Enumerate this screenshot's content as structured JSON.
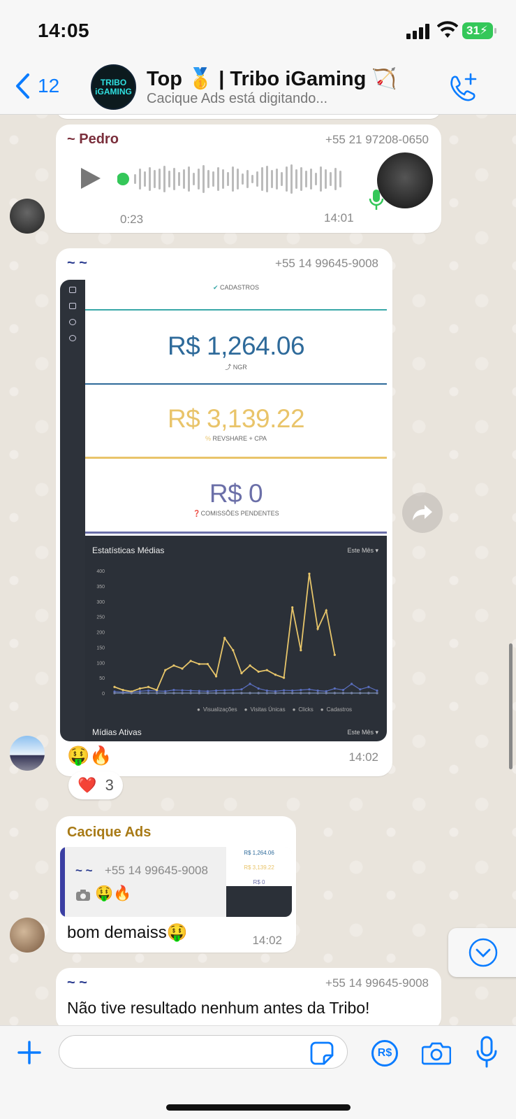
{
  "status": {
    "time": "14:05",
    "battery": "31"
  },
  "header": {
    "back_count": "12",
    "group_title": "Top 🥇 | Tribo iGaming 🏹",
    "subtitle": "Cacique Ads está digitando...",
    "avatar_text": "TRIBO iGAMING"
  },
  "messages": [
    {
      "sender": "~ Pedro",
      "phone": "+55 21 97208-0650",
      "type": "voice",
      "duration": "0:23",
      "time": "14:01"
    },
    {
      "sender": "~ ~",
      "phone": "+55 14 99645-9008",
      "type": "image",
      "caption": "🤑🔥",
      "time": "14:02",
      "reaction": {
        "emoji": "❤️",
        "count": "3"
      }
    },
    {
      "sender": "Cacique Ads",
      "quote": {
        "sender": "~ ~",
        "phone": "+55 14 99645-9008",
        "preview": "🤑🔥"
      },
      "text": "bom demaiss🤑",
      "time": "14:02"
    },
    {
      "sender": "~ ~",
      "phone": "+55 14 99645-9008",
      "text": "Não tive resultado nenhum antes da Tribo!"
    }
  ],
  "dashboard": {
    "cadastros_label": "CADASTROS",
    "ngr_value": "R$ 1,264.06",
    "ngr_label": "NGR",
    "revshare_value": "R$ 3,139.22",
    "revshare_label": "REVSHARE + CPA",
    "pending_value": "R$ 0",
    "pending_label": "COMISSÕES PENDENTES",
    "chart_title": "Estatísticas Médias",
    "period": "Este Mês",
    "bottom_title": "Mídias Ativas",
    "bottom_period": "Este Mês",
    "yticks": [
      "400",
      "350",
      "300",
      "250",
      "200",
      "150",
      "100",
      "50",
      "0"
    ]
  },
  "chart_data": {
    "type": "line",
    "title": "Estatísticas Médias",
    "ylim": [
      0,
      400
    ],
    "series": [
      {
        "name": "Visualizações",
        "color": "#3aa8a8",
        "values": [
          0,
          0,
          0,
          0,
          0,
          0,
          0,
          0,
          0,
          0,
          0,
          0,
          0,
          0,
          0,
          0,
          0,
          0,
          0,
          0,
          0,
          0,
          0,
          0,
          0,
          0,
          0,
          0,
          0,
          0,
          0,
          0
        ]
      },
      {
        "name": "Visitas Únicas",
        "color": "#5a6fc0",
        "values": [
          5,
          3,
          4,
          6,
          8,
          7,
          6,
          10,
          9,
          8,
          7,
          6,
          8,
          9,
          10,
          12,
          30,
          15,
          8,
          6,
          9,
          8,
          10,
          12,
          8,
          6,
          15,
          10,
          30,
          12,
          20,
          8
        ]
      },
      {
        "name": "Clicks",
        "color": "#e7c56a",
        "values": [
          20,
          10,
          5,
          15,
          20,
          10,
          75,
          90,
          80,
          105,
          95,
          95,
          55,
          180,
          140,
          65,
          90,
          70,
          75,
          60,
          50,
          280,
          140,
          390,
          210,
          270,
          125,
          0,
          0,
          0,
          0,
          0
        ]
      },
      {
        "name": "Cadastros",
        "color": "#7c82a8",
        "values": [
          0,
          0,
          0,
          0,
          0,
          0,
          0,
          0,
          0,
          0,
          0,
          0,
          0,
          0,
          0,
          0,
          0,
          0,
          0,
          0,
          0,
          0,
          0,
          0,
          0,
          0,
          0,
          0,
          0,
          0,
          0,
          0
        ]
      }
    ]
  },
  "composer": {
    "placeholder": ""
  },
  "colors": {
    "accent": "#0a7cff",
    "pedro_name": "#7a2e3b",
    "cacique_name": "#a87a16",
    "tilde_name": "#2a3b8f"
  }
}
